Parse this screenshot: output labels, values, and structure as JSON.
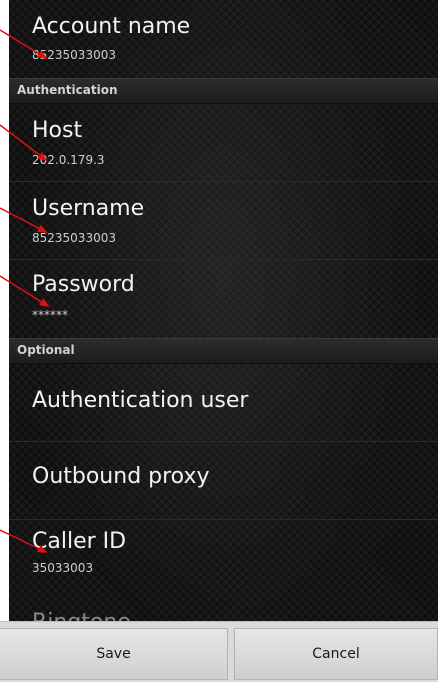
{
  "preferences": {
    "account_name": {
      "title": "Account name",
      "summary": "85235033003"
    },
    "authentication_category": "Authentication",
    "host": {
      "title": "Host",
      "summary": "202.0.179.3"
    },
    "username": {
      "title": "Username",
      "summary": "85235033003"
    },
    "password": {
      "title": "Password",
      "summary": "******"
    },
    "optional_category": "Optional",
    "authentication_user": {
      "title": "Authentication user"
    },
    "outbound_proxy": {
      "title": "Outbound proxy"
    },
    "caller_id": {
      "title": "Caller ID",
      "summary": "35033003"
    },
    "ringtone_partial": {
      "title": "Ringtone"
    }
  },
  "buttons": {
    "save": "Save",
    "cancel": "Cancel"
  },
  "colors": {
    "annotation_arrow": "#e01010",
    "button_bar": "#dadada",
    "category_header": "#262626"
  }
}
